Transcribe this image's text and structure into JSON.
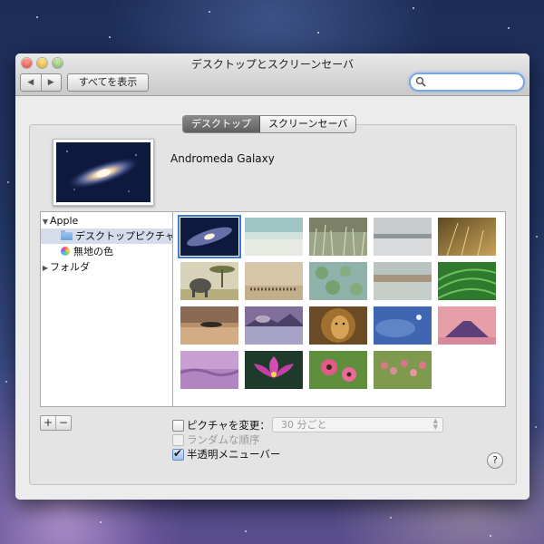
{
  "window": {
    "title": "デスクトップとスクリーンセーバ",
    "show_all_label": "すべてを表示",
    "search_placeholder": ""
  },
  "tabs": [
    {
      "label": "デスクトップ",
      "active": true
    },
    {
      "label": "スクリーンセーバ",
      "active": false
    }
  ],
  "current_wallpaper": {
    "name": "Andromeda Galaxy"
  },
  "sources": [
    {
      "label": "Apple",
      "kind": "group",
      "expanded": true
    },
    {
      "label": "デスクトップピクチャ",
      "kind": "folder",
      "selected": true
    },
    {
      "label": "無地の色",
      "kind": "colors",
      "selected": false
    },
    {
      "label": "フォルダ",
      "kind": "group",
      "expanded": false
    }
  ],
  "thumbnails": [
    {
      "icon": "galaxy",
      "selected": true
    },
    {
      "icon": "sea"
    },
    {
      "icon": "grass"
    },
    {
      "icon": "fog-lake"
    },
    {
      "icon": "golden-grass"
    },
    {
      "icon": "elephant"
    },
    {
      "icon": "zebras"
    },
    {
      "icon": "lily-pads"
    },
    {
      "icon": "misty-field"
    },
    {
      "icon": "green-leaves"
    },
    {
      "icon": "island-dusk"
    },
    {
      "icon": "mountain-lake"
    },
    {
      "icon": "lion"
    },
    {
      "icon": "moon-sky"
    },
    {
      "icon": "mount-fuji"
    },
    {
      "icon": "purple-mist"
    },
    {
      "icon": "lotus"
    },
    {
      "icon": "pink-flowers"
    },
    {
      "icon": "berries"
    }
  ],
  "controls": {
    "add_label": "+",
    "remove_label": "−",
    "change_picture_label": "ピクチャを変更：",
    "change_picture_checked": false,
    "interval_value": "30 分ごと",
    "random_order_label": "ランダムな順序",
    "random_order_checked": false,
    "translucent_menu_label": "半透明メニューバー",
    "translucent_menu_checked": true,
    "help_label": "?"
  }
}
